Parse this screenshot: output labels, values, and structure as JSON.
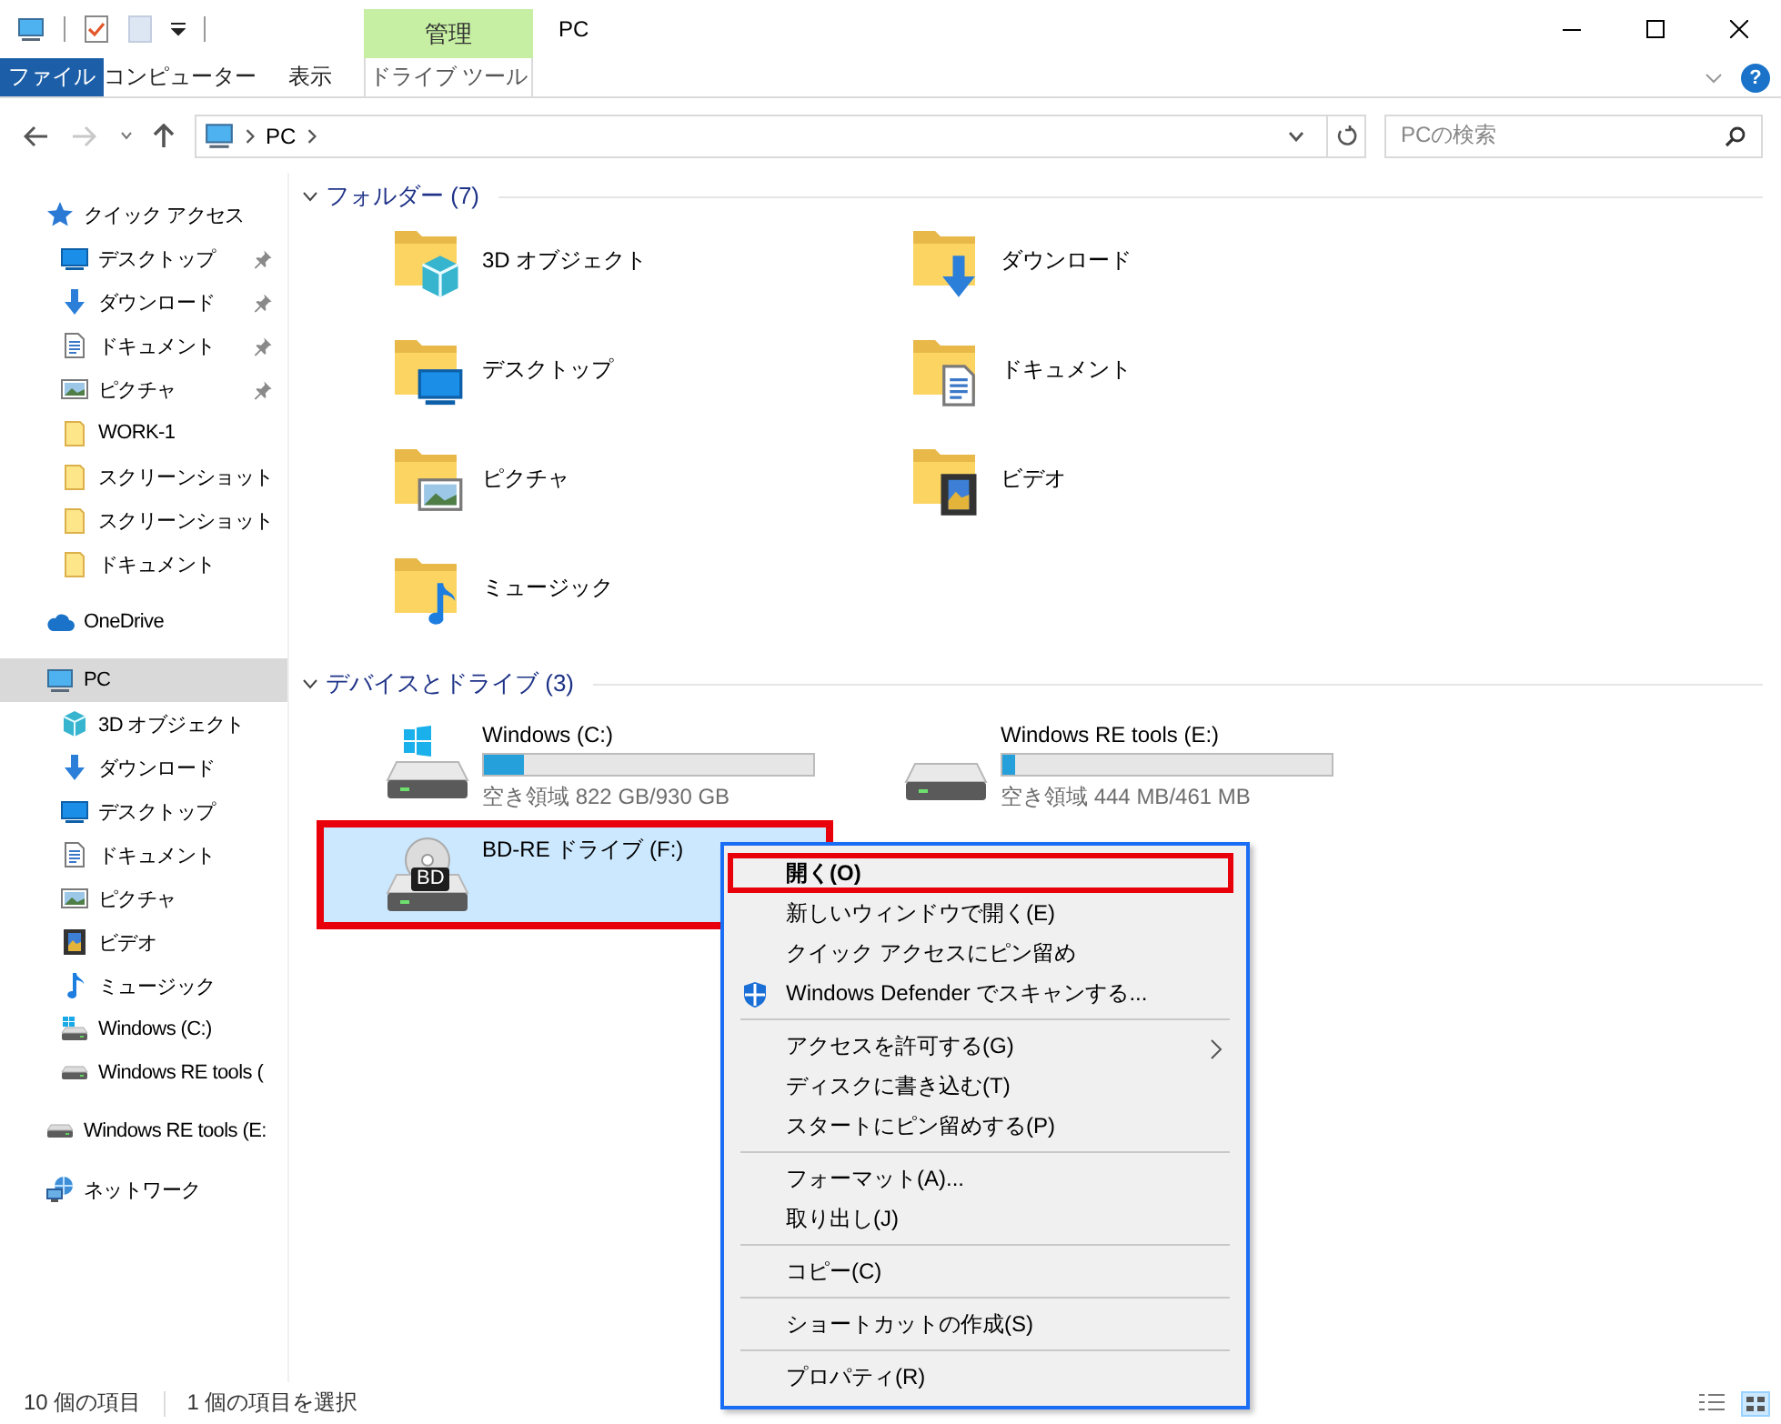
{
  "title_bar": {
    "context_group": "管理",
    "title": "PC"
  },
  "ribbon": {
    "tabs": [
      {
        "label": "ファイル",
        "kind": "file",
        "selected": false
      },
      {
        "label": "コンピューター",
        "kind": "normal",
        "selected": false
      },
      {
        "label": "表示",
        "kind": "normal",
        "selected": false
      },
      {
        "label": "ドライブ ツール",
        "kind": "contextual",
        "selected": false
      }
    ],
    "help": "?"
  },
  "navigation": {
    "back_disabled": false,
    "forward_disabled": true,
    "up_disabled": false
  },
  "address": {
    "segments": [
      "PC"
    ]
  },
  "search": {
    "placeholder": "PCの検索"
  },
  "sidebar": {
    "items": [
      {
        "label": "クイック アクセス",
        "kind": "star",
        "selected": false,
        "children": [
          {
            "label": "デスクトップ",
            "kind": "desktop",
            "selected": false,
            "pinned": true
          },
          {
            "label": "ダウンロード",
            "kind": "download",
            "selected": false,
            "pinned": true
          },
          {
            "label": "ドキュメント",
            "kind": "document",
            "selected": false,
            "pinned": true
          },
          {
            "label": "ピクチャ",
            "kind": "picture",
            "selected": false,
            "pinned": true
          },
          {
            "label": "WORK-1",
            "kind": "folder",
            "selected": false,
            "pinned": false
          },
          {
            "label": "スクリーンショット",
            "kind": "folder",
            "selected": false,
            "pinned": false
          },
          {
            "label": "スクリーンショット",
            "kind": "folder",
            "selected": false,
            "pinned": false
          },
          {
            "label": "ドキュメント",
            "kind": "folder",
            "selected": false,
            "pinned": false
          }
        ]
      },
      {
        "label": "OneDrive",
        "kind": "cloud",
        "selected": false
      },
      {
        "label": "PC",
        "kind": "pc",
        "selected": true,
        "children": [
          {
            "label": "3D オブジェクト",
            "kind": "cube",
            "selected": false
          },
          {
            "label": "ダウンロード",
            "kind": "download",
            "selected": false
          },
          {
            "label": "デスクトップ",
            "kind": "desktop",
            "selected": false
          },
          {
            "label": "ドキュメント",
            "kind": "document",
            "selected": false
          },
          {
            "label": "ピクチャ",
            "kind": "picture",
            "selected": false
          },
          {
            "label": "ビデオ",
            "kind": "video",
            "selected": false
          },
          {
            "label": "ミュージック",
            "kind": "music",
            "selected": false
          },
          {
            "label": "Windows (C:)",
            "kind": "system-drive",
            "selected": false
          },
          {
            "label": "Windows RE tools (",
            "kind": "drive",
            "selected": false
          }
        ]
      },
      {
        "label": "Windows RE tools (E:",
        "kind": "drive",
        "selected": false
      },
      {
        "label": "ネットワーク",
        "kind": "network",
        "selected": false
      }
    ]
  },
  "folders": {
    "title": "フォルダー (7)",
    "expanded": true,
    "items": [
      {
        "label": "3D オブジェクト",
        "kind": "cube"
      },
      {
        "label": "ダウンロード",
        "kind": "download"
      },
      {
        "label": "デスクトップ",
        "kind": "desktop"
      },
      {
        "label": "ドキュメント",
        "kind": "document"
      },
      {
        "label": "ピクチャ",
        "kind": "picture"
      },
      {
        "label": "ビデオ",
        "kind": "video"
      },
      {
        "label": "ミュージック",
        "kind": "music"
      }
    ]
  },
  "drives": {
    "title": "デバイスとドライブ (3)",
    "expanded": true,
    "items": [
      {
        "label": "Windows (C:)",
        "kind": "system-drive",
        "level": 0.12,
        "free": "空き領域 822 GB/930 GB",
        "selected": false,
        "annotated": false
      },
      {
        "label": "Windows RE tools (E:)",
        "kind": "drive",
        "level": 0.04,
        "free": "空き領域 444 MB/461 MB",
        "selected": false,
        "annotated": false
      },
      {
        "label": "BD-RE ドライブ (F:)",
        "kind": "optical",
        "badge": "BD",
        "selected": true,
        "annotated": true
      }
    ]
  },
  "context_menu": {
    "groups": [
      {
        "items": [
          {
            "label": "開く(O)",
            "kind": "plain",
            "default": true,
            "annotated": true
          },
          {
            "label": "新しいウィンドウで開く(E)",
            "kind": "plain",
            "default": false,
            "annotated": false
          },
          {
            "label": "クイック アクセスにピン留め",
            "kind": "plain",
            "default": false,
            "annotated": false
          },
          {
            "label": "Windows Defender でスキャンする...",
            "kind": "shield",
            "default": false,
            "annotated": false
          }
        ]
      },
      {
        "items": [
          {
            "label": "アクセスを許可する(G)",
            "kind": "submenu",
            "default": false,
            "annotated": false
          },
          {
            "label": "ディスクに書き込む(T)",
            "kind": "plain",
            "default": false,
            "annotated": false
          },
          {
            "label": "スタートにピン留めする(P)",
            "kind": "plain",
            "default": false,
            "annotated": false
          }
        ]
      },
      {
        "items": [
          {
            "label": "フォーマット(A)...",
            "kind": "plain",
            "default": false,
            "annotated": false
          },
          {
            "label": "取り出し(J)",
            "kind": "plain",
            "default": false,
            "annotated": false
          }
        ]
      },
      {
        "items": [
          {
            "label": "コピー(C)",
            "kind": "plain",
            "default": false,
            "annotated": false
          }
        ]
      },
      {
        "items": [
          {
            "label": "ショートカットの作成(S)",
            "kind": "plain",
            "default": false,
            "annotated": false
          }
        ]
      },
      {
        "items": [
          {
            "label": "プロパティ(R)",
            "kind": "plain",
            "default": false,
            "annotated": false
          }
        ]
      }
    ]
  },
  "status_bar": {
    "item_count": "10 個の項目",
    "selection": "1 個の項目を選択"
  }
}
